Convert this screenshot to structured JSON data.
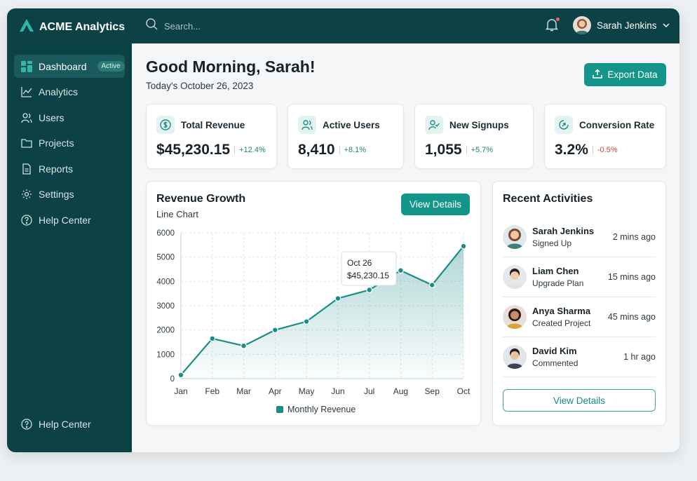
{
  "app": {
    "brand_name": "ACME Analytics"
  },
  "sidebar": {
    "items": [
      {
        "label": "Dashboard",
        "badge": "Active",
        "icon": "dashboard-grid-icon"
      },
      {
        "label": "Analytics",
        "icon": "line-chart-icon"
      },
      {
        "label": "Users",
        "icon": "users-icon"
      },
      {
        "label": "Projects",
        "icon": "folder-icon"
      },
      {
        "label": "Reports",
        "icon": "document-icon"
      },
      {
        "label": "Settings",
        "icon": "gear-icon"
      },
      {
        "label": "Help Center",
        "icon": "help-icon"
      }
    ],
    "bottom_item": {
      "label": "Help Center",
      "icon": "help-icon"
    }
  },
  "topbar": {
    "search_placeholder": "Search...",
    "user_name": "Sarah Jenkins"
  },
  "header": {
    "greeting": "Good Morning, Sarah!",
    "date": "Today's October 26, 2023",
    "export_label": "Export Data"
  },
  "stats": [
    {
      "title": "Total Revenue",
      "value": "$45,230.15",
      "change": "+12.4%",
      "icon": "dollar-icon",
      "trend": "up"
    },
    {
      "title": "Active Users",
      "value": "8,410",
      "change": "+8.1%",
      "icon": "users-icon",
      "trend": "up"
    },
    {
      "title": "New Signups",
      "value": "1,055",
      "change": "+5.7%",
      "icon": "user-check-icon",
      "trend": "up"
    },
    {
      "title": "Conversion Rate",
      "value": "3.2%",
      "change": "-0.5%",
      "icon": "conversion-icon",
      "trend": "down"
    }
  ],
  "revenue_chart": {
    "title": "Revenue Growth",
    "subtitle": "Line Chart",
    "button_label": "View Details",
    "tooltip": {
      "date": "Oct 26",
      "value": "$45,230.15"
    }
  },
  "chart_data": {
    "type": "area",
    "categories": [
      "Jan",
      "Feb",
      "Mar",
      "Apr",
      "May",
      "Jun",
      "Jul",
      "Aug",
      "Sep",
      "Oct"
    ],
    "series": [
      {
        "name": "Monthly Revenue",
        "values": [
          150,
          1650,
          1350,
          2000,
          2350,
          3300,
          3650,
          4450,
          3850,
          5450
        ]
      }
    ],
    "ylim": [
      0,
      6000
    ],
    "yticks": [
      0,
      1000,
      2000,
      3000,
      4000,
      5000,
      6000
    ],
    "grid": true,
    "legend": "bottom",
    "color": "#1b8d86"
  },
  "activities": {
    "title": "Recent Activities",
    "items": [
      {
        "name": "Sarah Jenkins",
        "action": "Signed Up",
        "time": "2 mins ago"
      },
      {
        "name": "Liam Chen",
        "action": "Upgrade Plan",
        "time": "15 mins ago"
      },
      {
        "name": "Anya Sharma",
        "action": "Created Project",
        "time": "45 mins ago"
      },
      {
        "name": "David Kim",
        "action": "Commented",
        "time": "1 hr ago"
      }
    ],
    "button_label": "View Details"
  },
  "colors": {
    "sidebar_bg": "#0c4245",
    "accent": "#14958a",
    "positive": "#1f8a55",
    "negative": "#d0453a"
  }
}
